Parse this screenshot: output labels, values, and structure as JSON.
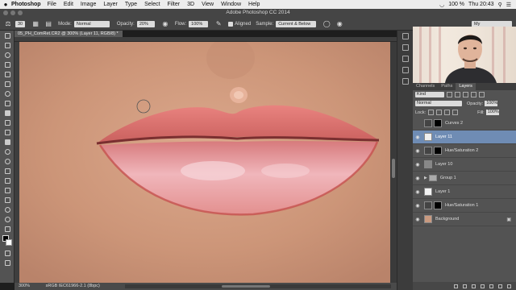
{
  "menubar": {
    "app": "Photoshop",
    "items": [
      "File",
      "Edit",
      "Image",
      "Layer",
      "Type",
      "Select",
      "Filter",
      "3D",
      "View",
      "Window",
      "Help"
    ],
    "battery": "100 %",
    "clock": "Thu 20:43"
  },
  "window": {
    "title": "Adobe Photoshop CC 2014",
    "workspace": "My"
  },
  "options": {
    "brush_size": "30",
    "mode_label": "Mode:",
    "mode_value": "Normal",
    "opacity_label": "Opacity:",
    "opacity_value": "20%",
    "flow_label": "Flow:",
    "flow_value": "100%",
    "aligned_label": "Aligned",
    "sample_label": "Sample:",
    "sample_value": "Current & Below"
  },
  "document": {
    "tab": "05_PH_ComRet.CR2 @ 300% (Layer 11, RGB/8) *",
    "zoom": "300%",
    "profile": "sRGB IEC61966-2.1 (8bpc)"
  },
  "panel": {
    "tabs": [
      "Channels",
      "Paths",
      "Layers"
    ],
    "active_tab": "Layers",
    "filter_value": "Kind",
    "blend_mode": "Normal",
    "opacity_label": "Opacity:",
    "opacity_value": "100%",
    "lock_label": "Lock:",
    "fill_label": "Fill:",
    "fill_value": "100%"
  },
  "layers": [
    {
      "name": "Curves 2",
      "visible": false,
      "type": "adjustment",
      "active": false
    },
    {
      "name": "Layer 11",
      "visible": true,
      "type": "pixel",
      "active": true
    },
    {
      "name": "Hue/Saturation 2",
      "visible": true,
      "type": "adjustment",
      "active": false
    },
    {
      "name": "Layer 10",
      "visible": true,
      "type": "pixel",
      "active": false
    },
    {
      "name": "Group 1",
      "visible": true,
      "type": "group",
      "active": false
    },
    {
      "name": "Layer 1",
      "visible": true,
      "type": "pixel",
      "active": false
    },
    {
      "name": "Hue/Saturation 1",
      "visible": true,
      "type": "adjustment",
      "active": false
    },
    {
      "name": "Background",
      "visible": true,
      "type": "background",
      "active": false
    }
  ],
  "colors": {
    "active_layer": "#6f8cb4",
    "foreground": "#000000",
    "background": "#ffffff",
    "lip": "#d97a78"
  }
}
